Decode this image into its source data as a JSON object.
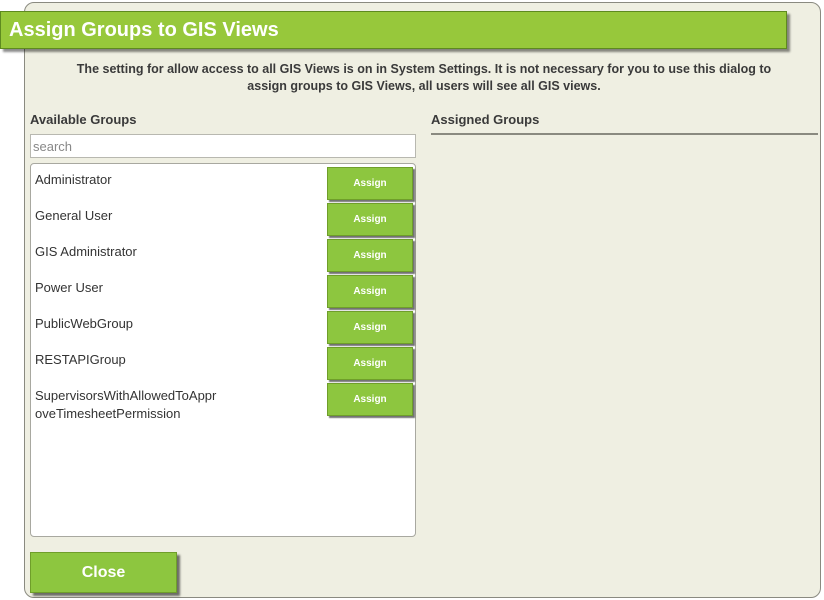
{
  "dialog": {
    "title": "Assign Groups to GIS Views",
    "notice": "The setting for allow access to all GIS Views is on in System Settings. It is not necessary for you to use this dialog to assign groups to GIS Views, all users will see all GIS views."
  },
  "available": {
    "label": "Available Groups",
    "search_placeholder": "search",
    "search_value": "",
    "assign_label": "Assign",
    "groups": [
      "Administrator",
      "General User",
      "GIS Administrator",
      "Power User",
      "PublicWebGroup",
      "RESTAPIGroup",
      "SupervisorsWithAllowedToApprove TimesheetPermission"
    ],
    "last_group_line1": "SupervisorsWithAllowedToAppr",
    "last_group_line2": "oveTimesheetPermission"
  },
  "assigned": {
    "label": "Assigned Groups"
  },
  "footer": {
    "close_label": "Close"
  },
  "colors": {
    "accent": "#97c83b",
    "button": "#8dc63f",
    "background": "#efefe2"
  }
}
